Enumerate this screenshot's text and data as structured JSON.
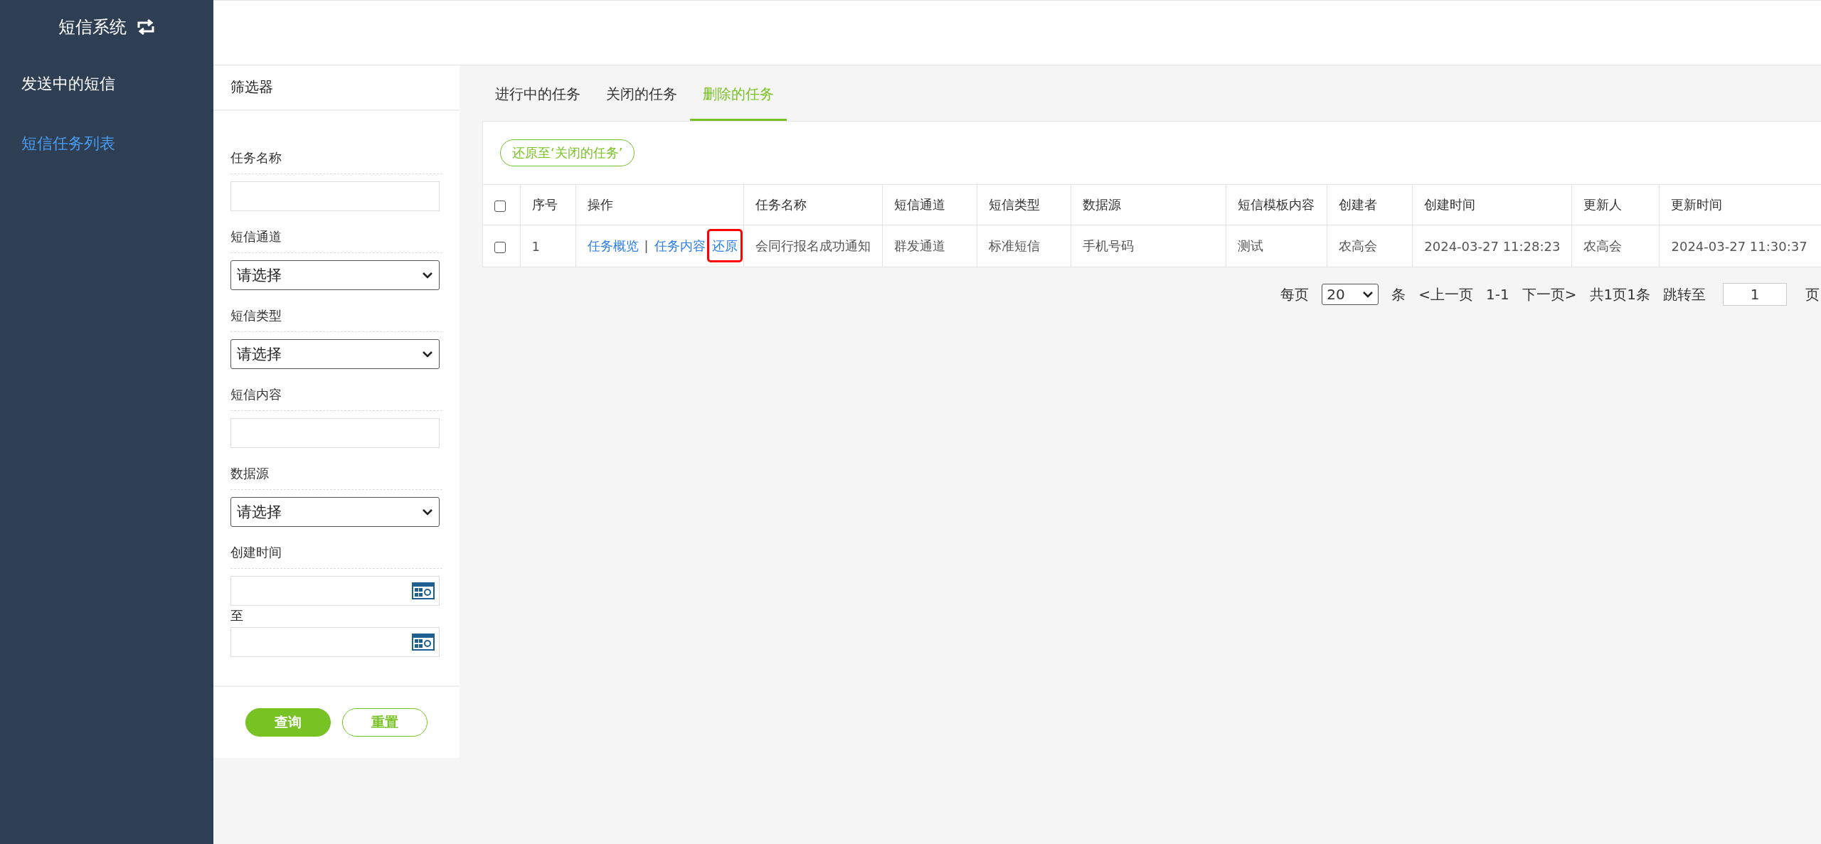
{
  "sidebar": {
    "title": "短信系统",
    "items": [
      {
        "label": "发送中的短信",
        "selected": false
      },
      {
        "label": "短信任务列表",
        "selected": true
      }
    ]
  },
  "filter": {
    "title": "筛选器",
    "fields": [
      {
        "kind": "text",
        "label": "任务名称"
      },
      {
        "kind": "select",
        "label": "短信通道",
        "value": "请选择"
      },
      {
        "kind": "select",
        "label": "短信类型",
        "value": "请选择"
      },
      {
        "kind": "text",
        "label": "短信内容"
      },
      {
        "kind": "select",
        "label": "数据源",
        "value": "请选择"
      },
      {
        "kind": "daterange",
        "label": "创建时间",
        "separator": "至"
      }
    ],
    "buttons": [
      {
        "kind": "primary",
        "label": "查询"
      },
      {
        "kind": "secondary",
        "label": "重置"
      }
    ]
  },
  "tabs": [
    {
      "label": "进行中的任务",
      "selected": false
    },
    {
      "label": "关闭的任务",
      "selected": false
    },
    {
      "label": "删除的任务",
      "selected": true
    }
  ],
  "toolbar": {
    "restore_button": "还原至‘关闭的任务’"
  },
  "table": {
    "header_checked": false,
    "columns": [
      "序号",
      "操作",
      "任务名称",
      "短信通道",
      "短信类型",
      "数据源",
      "短信模板内容",
      "创建者",
      "创建时间",
      "更新人",
      "更新时间"
    ],
    "rows": [
      {
        "checked": false,
        "cells": [
          {
            "kind": "text",
            "text": "1"
          },
          {
            "kind": "actions",
            "actions": [
              {
                "kind": "link",
                "label": "任务概览",
                "highlighted": false
              },
              {
                "kind": "separator",
                "label": "|"
              },
              {
                "kind": "link",
                "label": "任务内容",
                "highlighted": false
              },
              {
                "kind": "link",
                "label": "还原",
                "highlighted": true
              }
            ]
          },
          {
            "kind": "text",
            "text": "会同行报名成功通知"
          },
          {
            "kind": "text",
            "text": "群发通道"
          },
          {
            "kind": "text",
            "text": "标准短信"
          },
          {
            "kind": "text",
            "text": "手机号码"
          },
          {
            "kind": "text",
            "text": "测试"
          },
          {
            "kind": "text",
            "text": "农高会"
          },
          {
            "kind": "text",
            "text": "2024-03-27 11:28:23"
          },
          {
            "kind": "text",
            "text": "农高会"
          },
          {
            "kind": "text",
            "text": "2024-03-27 11:30:37"
          }
        ]
      }
    ]
  },
  "pagination": {
    "per_page_label": "每页",
    "per_page": "20",
    "unit": "条",
    "prev": "<上一页",
    "range": "1-1",
    "next": "下一页>",
    "summary": "共1页1条",
    "jump_label": "跳转至",
    "jump_value": "1",
    "page_label": "页"
  }
}
